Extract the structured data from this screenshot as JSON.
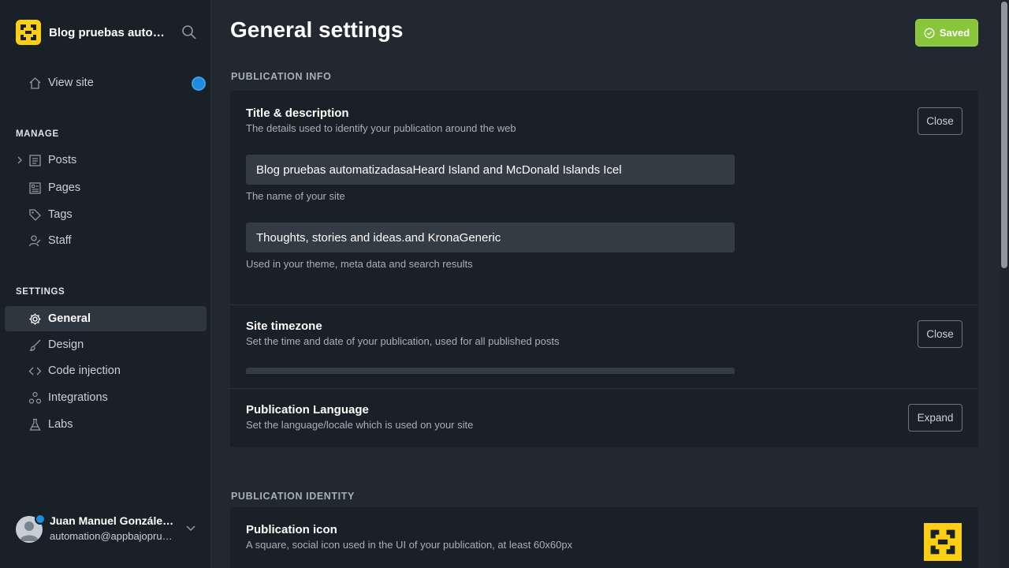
{
  "brand": {
    "title": "Blog pruebas autom…"
  },
  "sidebar": {
    "view_site": "View site",
    "manage_heading": "MANAGE",
    "manage_items": [
      {
        "label": "Posts",
        "icon": "posts-icon"
      },
      {
        "label": "Pages",
        "icon": "pages-icon"
      },
      {
        "label": "Tags",
        "icon": "tag-icon"
      },
      {
        "label": "Staff",
        "icon": "staff-icon"
      }
    ],
    "settings_heading": "SETTINGS",
    "settings_items": [
      {
        "label": "General",
        "icon": "gear-icon",
        "active": true
      },
      {
        "label": "Design",
        "icon": "brush-icon"
      },
      {
        "label": "Code injection",
        "icon": "code-icon"
      },
      {
        "label": "Integrations",
        "icon": "integrations-icon"
      },
      {
        "label": "Labs",
        "icon": "flask-icon"
      }
    ]
  },
  "user": {
    "name": "Juan Manuel Gonzále…",
    "email": "automation@appbajopru…"
  },
  "main": {
    "title": "General settings",
    "saved_label": "Saved",
    "publication_info_heading": "PUBLICATION INFO",
    "title_desc": {
      "title": "Title & description",
      "desc": "The details used to identify your publication around the web",
      "button": "Close",
      "site_title_value": "Blog pruebas automatizadasaHeard Island and McDonald Islands Icel",
      "site_title_hint": "The name of your site",
      "site_desc_value": "Thoughts, stories and ideas.and KronaGeneric",
      "site_desc_hint": "Used in your theme, meta data and search results"
    },
    "timezone": {
      "title": "Site timezone",
      "desc": "Set the time and date of your publication, used for all published posts",
      "button": "Close"
    },
    "language": {
      "title": "Publication Language",
      "desc": "Set the language/locale which is used on your site",
      "button": "Expand"
    },
    "publication_identity_heading": "PUBLICATION IDENTITY",
    "pub_icon": {
      "title": "Publication icon",
      "desc": "A square, social icon used in the UI of your publication, at least 60x60px"
    }
  },
  "colors": {
    "accent_green": "#8ac63b",
    "brand_yellow": "#fdcf14",
    "notification_blue": "#1c8be0"
  }
}
